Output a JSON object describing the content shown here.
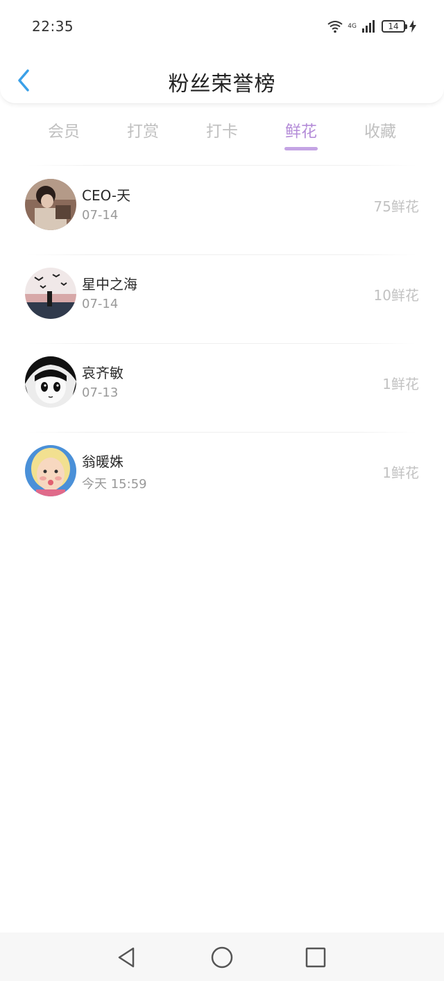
{
  "status_bar": {
    "time": "22:35",
    "network": "4G",
    "battery": "14"
  },
  "header": {
    "title": "粉丝荣誉榜",
    "back_icon": "chevron-left-icon"
  },
  "tabs": [
    {
      "label": "会员",
      "active": false
    },
    {
      "label": "打赏",
      "active": false
    },
    {
      "label": "打卡",
      "active": false
    },
    {
      "label": "鲜花",
      "active": true
    },
    {
      "label": "收藏",
      "active": false
    }
  ],
  "fans": [
    {
      "name": "CEO-天",
      "date": "07-14",
      "count": "75鲜花"
    },
    {
      "name": "星中之海",
      "date": "07-14",
      "count": "10鲜花"
    },
    {
      "name": "哀齐敏",
      "date": "07-13",
      "count": "1鲜花"
    },
    {
      "name": "翁暖姝",
      "date": "今天 15:59",
      "count": "1鲜花"
    }
  ],
  "nav": {
    "back": "triangle-back-icon",
    "home": "circle-home-icon",
    "recents": "square-recents-icon"
  },
  "colors": {
    "accent": "#b48cd8",
    "back_arrow": "#3aa0e8",
    "muted": "#c2c2c2"
  }
}
